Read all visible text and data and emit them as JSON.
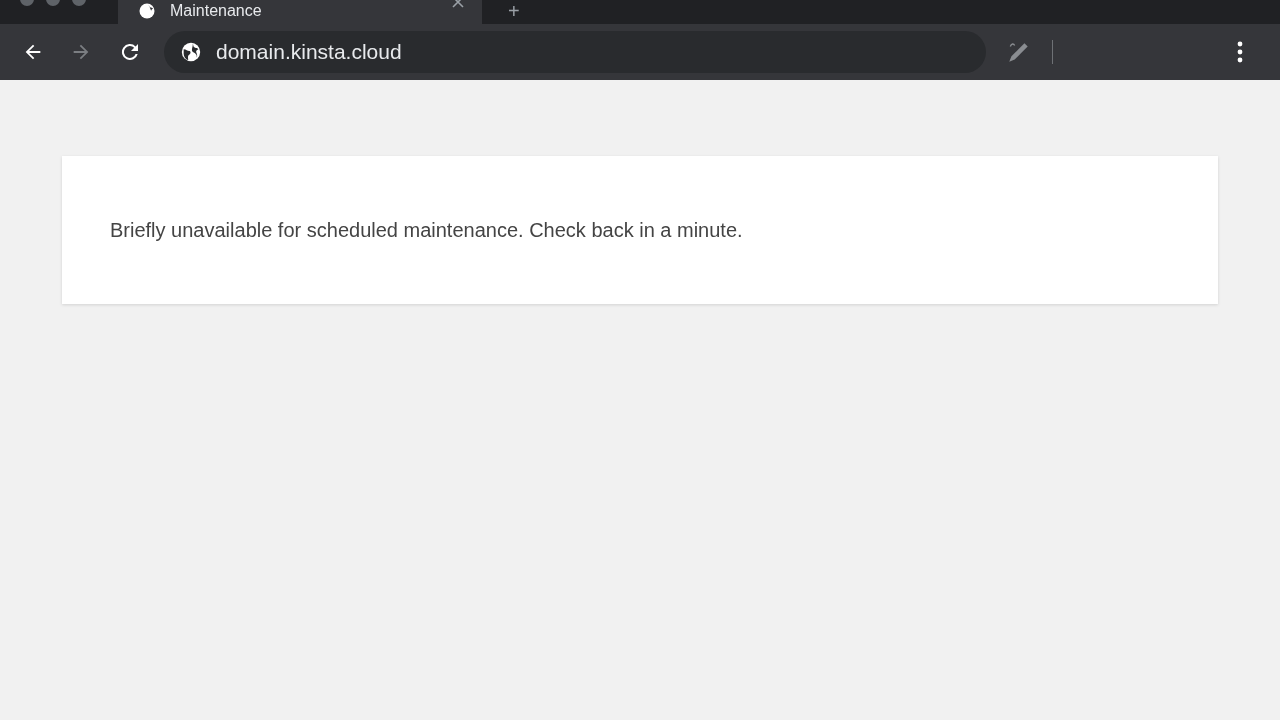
{
  "tabs": [
    {
      "title": "Maintenance",
      "selected": true
    }
  ],
  "new_tab": "+",
  "toolbar": {
    "forward_disabled": true,
    "url": "domain.kinsta.cloud"
  },
  "page": {
    "message": "Briefly unavailable for scheduled maintenance. Check back in a minute."
  }
}
